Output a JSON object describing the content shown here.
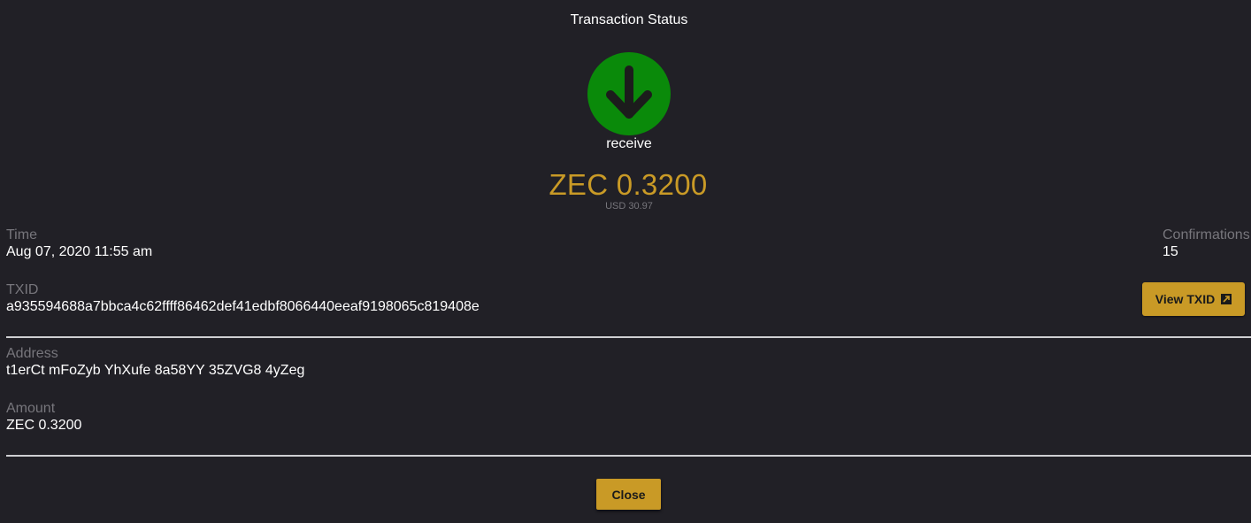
{
  "dialog": {
    "title": "Transaction Status",
    "type_label": "receive",
    "amount": "ZEC 0.3200",
    "usd_amount": "USD 30.97",
    "icon": "arrow-down-icon",
    "colors": {
      "accent": "#c99a26",
      "receive_green": "#0a8a0a",
      "background": "#212026",
      "muted_text": "#77767c"
    }
  },
  "details": {
    "time_label": "Time",
    "time_value": "Aug 07, 2020 11:55 am",
    "confirmations_label": "Confirmations",
    "confirmations_value": "15",
    "txid_label": "TXID",
    "txid_value": "a935594688a7bbca4c62ffff86462def41edbf8066440eeaf9198065c819408e",
    "view_txid_label": "View TXID",
    "address_label": "Address",
    "address_value": "t1erCt mFoZyb YhXufe 8a58YY 35ZVG8 4yZeg",
    "amount_label": "Amount",
    "amount_value": "ZEC 0.3200"
  },
  "footer": {
    "close_label": "Close"
  }
}
